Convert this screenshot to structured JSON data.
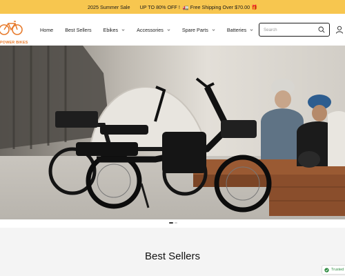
{
  "announcement": {
    "part1": "2025 Summer Sale",
    "part2": "UP TO 80% OFF !",
    "part3": "🚛 Free Shipping Over $70.00 🎁"
  },
  "brand": {
    "name": "POWER BIKES",
    "accent": "#e77a2b"
  },
  "nav": {
    "items": [
      {
        "label": "Home",
        "dropdown": false
      },
      {
        "label": "Best Sellers",
        "dropdown": false
      },
      {
        "label": "Ebikes",
        "dropdown": true
      },
      {
        "label": "Accessories",
        "dropdown": true
      },
      {
        "label": "Spare Parts",
        "dropdown": true
      },
      {
        "label": "Batteries",
        "dropdown": true
      }
    ]
  },
  "search": {
    "placeholder": "Search",
    "value": ""
  },
  "icons": {
    "search": "search-icon",
    "account": "user-icon",
    "chevron": "chevron-down-icon"
  },
  "hero": {
    "slide_index": 1,
    "slide_count": 2
  },
  "sections": {
    "best_sellers_title": "Best Sellers"
  },
  "badge": {
    "label": "Trusted"
  },
  "colors": {
    "announcement_bg": "#f7c64f",
    "accent": "#e77a2b",
    "section_bg": "#f4f4f4"
  }
}
